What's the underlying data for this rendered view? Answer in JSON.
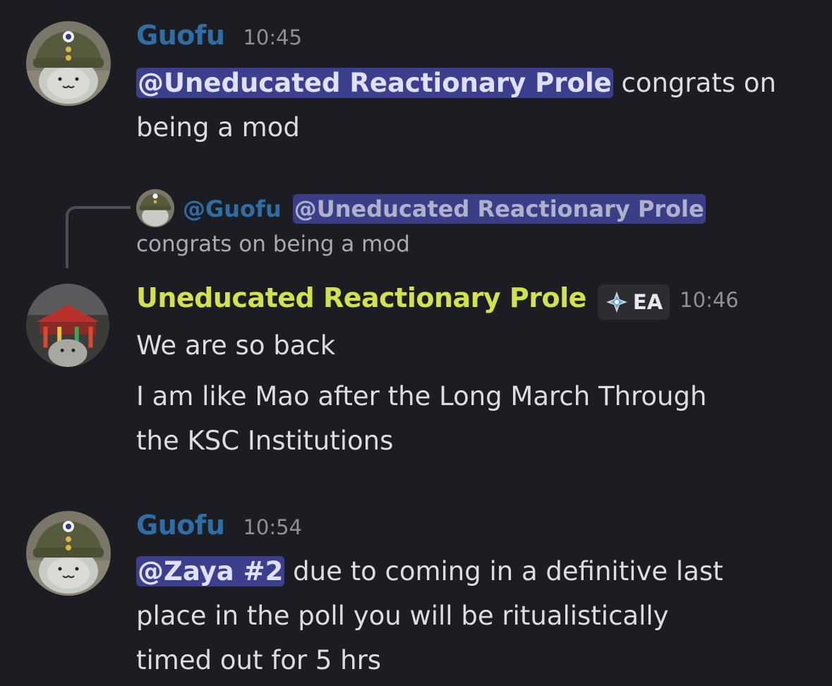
{
  "messages": [
    {
      "author": "Guofu",
      "time": "10:45",
      "mention": "@Uneducated Reactionary Prole",
      "text_line1": " congrats on",
      "text_line2": "being a mod"
    },
    {
      "reply": {
        "author": "@Guofu",
        "mention": "@Uneducated Reactionary Prole",
        "text": "congrats on being a mod"
      },
      "author": "Uneducated Reactionary Prole",
      "badge": "EA",
      "badge_icon": "diamond-compass-icon",
      "time": "10:46",
      "line1": "We are so back",
      "line2": "I am like Mao after the Long March Through",
      "line3": "the KSC Institutions"
    },
    {
      "author": "Guofu",
      "time": "10:54",
      "mention": "@Zaya #2",
      "text_line1": " due to coming in a definitive last",
      "text_line2": "place in the poll you will be ritualistically",
      "text_line3": "timed out for 5 hrs"
    }
  ],
  "colors": {
    "background": "#1c1d22",
    "guofu_name": "#2f6ea5",
    "prole_name": "#d3e14a",
    "mention_bg": "#3c3f8d",
    "timestamp": "#8e9097"
  }
}
